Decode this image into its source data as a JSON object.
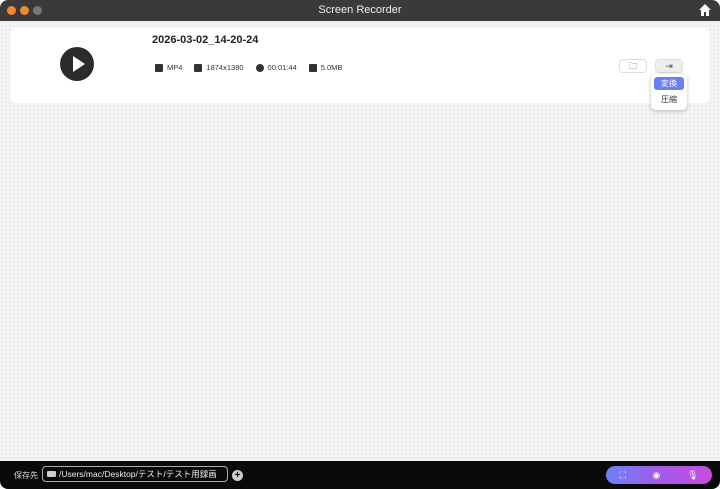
{
  "window": {
    "title": "Screen Recorder"
  },
  "recording": {
    "filename": "2026-03-02_14-20-24",
    "format": "MP4",
    "resolution": "1874x1380",
    "duration": "00:01:44",
    "size": "5.0MB"
  },
  "menu": {
    "items": [
      "変換",
      "圧縮"
    ]
  },
  "footer": {
    "save_label": "保存先",
    "path": "/Users/mac/Desktop/テスト/テスト用録画",
    "add": "+"
  },
  "icons": {
    "region": "⛶",
    "webcam": "◉",
    "mic": "🎙"
  }
}
